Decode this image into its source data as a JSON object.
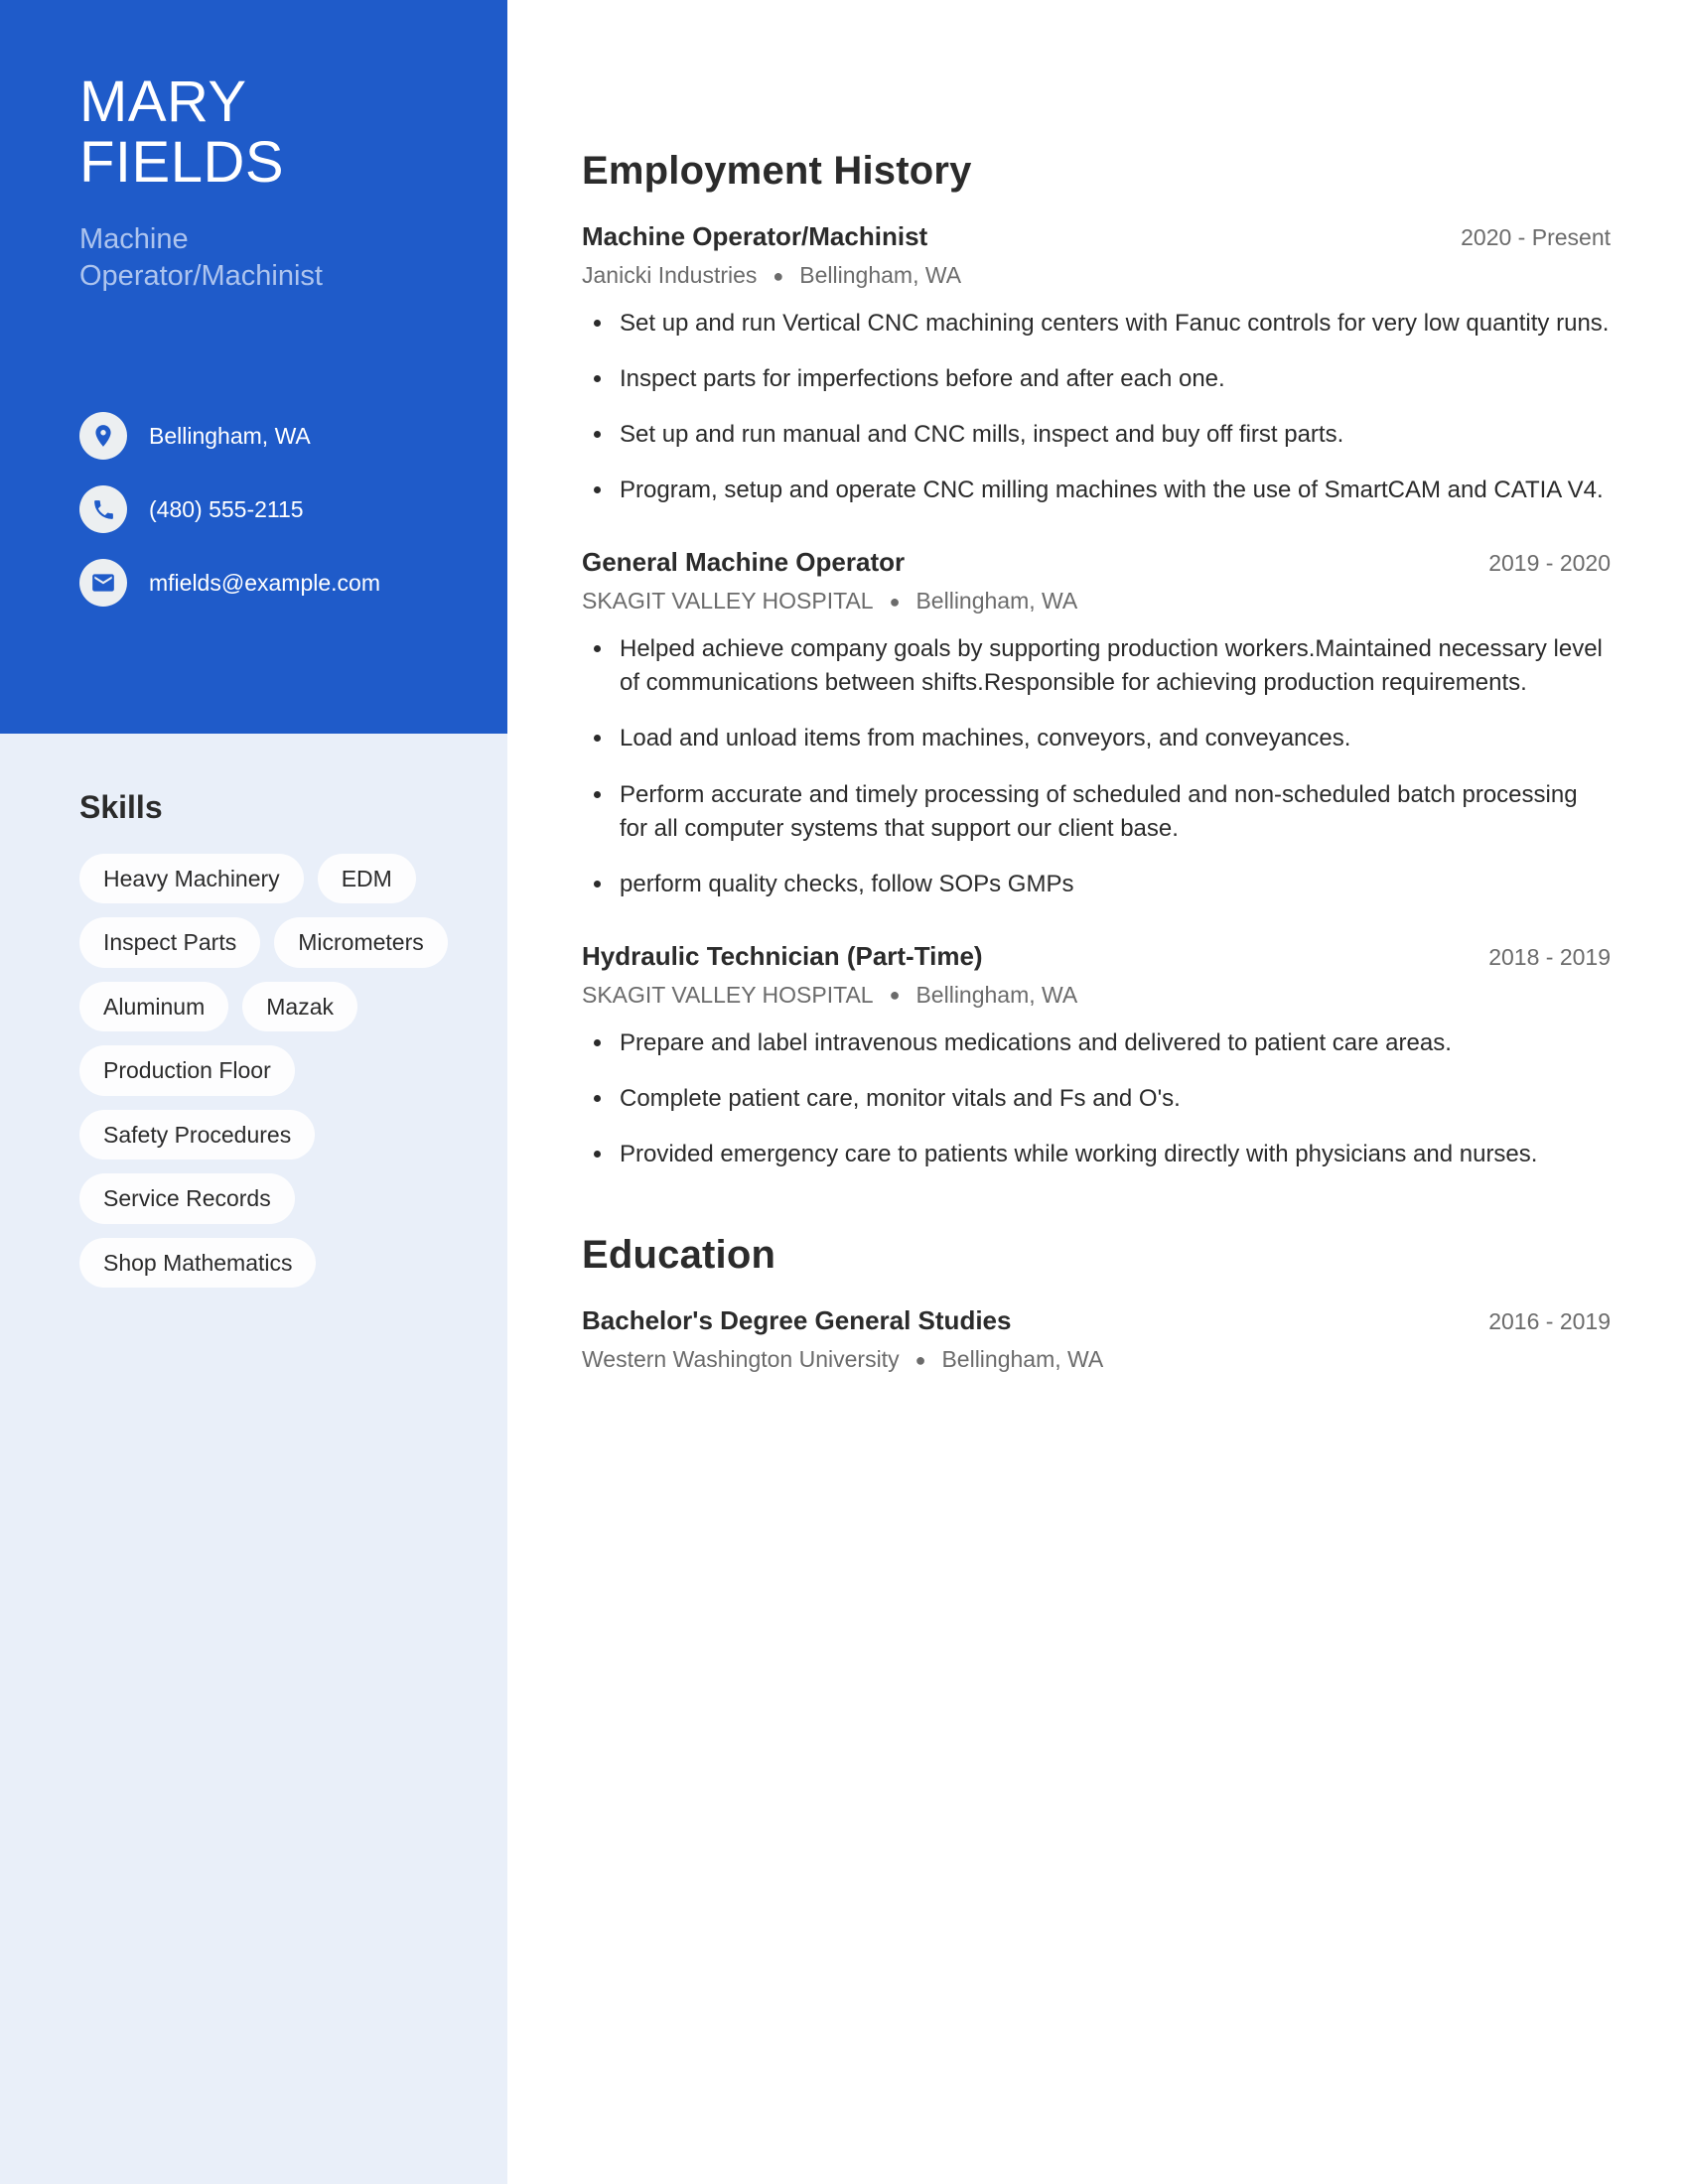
{
  "theme": {
    "accent": "#1f5bc9",
    "sidebar_bg": "#e9eff9",
    "pill_bg": "#fdfdfe",
    "text": "#2b2b2b",
    "muted": "#6b6b6b",
    "subtitle": "#adc4ee"
  },
  "profile": {
    "first_name": "MARY",
    "last_name": "FIELDS",
    "title_line1": "Machine",
    "title_line2": "Operator/Machinist"
  },
  "contact": [
    {
      "icon": "location-pin-icon",
      "value": "Bellingham, WA"
    },
    {
      "icon": "phone-icon",
      "value": "(480) 555-2115"
    },
    {
      "icon": "email-envelope-icon",
      "value": "mfields@example.com"
    }
  ],
  "skills": {
    "heading": "Skills",
    "items": [
      "Heavy Machinery",
      "EDM",
      "Inspect Parts",
      "Micrometers",
      "Aluminum",
      "Mazak",
      "Production Floor",
      "Safety Procedures",
      "Service Records",
      "Shop Mathematics"
    ]
  },
  "employment": {
    "heading": "Employment History",
    "entries": [
      {
        "title": "Machine Operator/Machinist",
        "dates": "2020 - Present",
        "company": "Janicki Industries",
        "location": "Bellingham, WA",
        "bullets": [
          "Set up and run Vertical CNC machining centers with Fanuc controls for very low quantity runs.",
          "Inspect parts for imperfections before and after each one.",
          "Set up and run manual and CNC mills, inspect and buy off first parts.",
          "Program, setup and operate CNC milling machines with the use of SmartCAM and CATIA V4."
        ]
      },
      {
        "title": "General Machine Operator",
        "dates": "2019 - 2020",
        "company": "SKAGIT VALLEY HOSPITAL",
        "location": "Bellingham, WA",
        "bullets": [
          "Helped achieve company goals by supporting production workers.Maintained necessary level of communications between shifts.Responsible for achieving production requirements.",
          "Load and unload items from machines, conveyors, and conveyances.",
          "Perform accurate and timely processing of scheduled and non-scheduled batch processing for all computer systems that support our client base.",
          "perform quality checks, follow SOPs GMPs"
        ]
      },
      {
        "title": "Hydraulic Technician (Part-Time)",
        "dates": "2018 - 2019",
        "company": "SKAGIT VALLEY HOSPITAL",
        "location": "Bellingham, WA",
        "bullets": [
          "Prepare and label intravenous medications and delivered to patient care areas.",
          "Complete patient care, monitor vitals and Fs and O's.",
          "Provided emergency care to patients while working directly with physicians and nurses."
        ]
      }
    ]
  },
  "education": {
    "heading": "Education",
    "entries": [
      {
        "title": "Bachelor's Degree General Studies",
        "dates": "2016 - 2019",
        "school": "Western Washington University",
        "location": "Bellingham, WA"
      }
    ]
  },
  "separator": "●"
}
